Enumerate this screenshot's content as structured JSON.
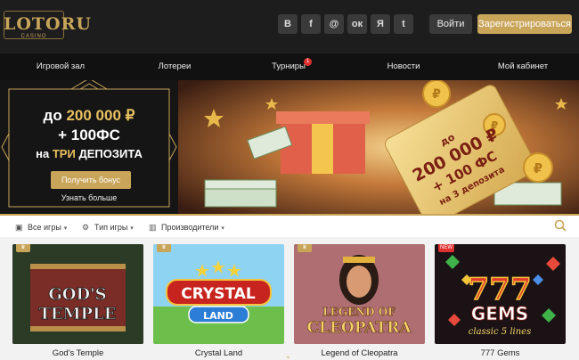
{
  "brand": {
    "logo_text": "LOTORU",
    "logo_sub": "CASINO"
  },
  "social": [
    "В",
    "f",
    "@",
    "ок",
    "Я",
    "t"
  ],
  "auth": {
    "login": "Войти",
    "register": "Зарегистрироваться"
  },
  "nav": {
    "items": [
      "Игровой зал",
      "Лотереи",
      "Турниры",
      "Новости",
      "Мой кабинет"
    ],
    "tournaments_badge": "1"
  },
  "promo": {
    "amount_prefix": "до",
    "amount": "200 000 ₽",
    "bonus": "+ 100ФС",
    "on_text": "на",
    "deposits_gold": "ТРИ",
    "deposits_text": "ДЕПОЗИТА",
    "button": "Получить бонус",
    "more": "Узнать больше"
  },
  "ticket": {
    "line1": "до",
    "line2": "200 000 ₽",
    "line3": "+ 100 ФС",
    "line4": "на 3 депозита"
  },
  "filters": {
    "all_games": "Все игры",
    "game_type": "Тип игры",
    "providers": "Производители"
  },
  "games": [
    {
      "name": "God's Temple",
      "art": "GOD'S TEMPLE",
      "tag": ""
    },
    {
      "name": "Crystal Land",
      "art": "CRYSTAL LAND",
      "tag": ""
    },
    {
      "name": "Legend of Cleopatra",
      "art": "LEGEND OF CLEOPATRA",
      "tag": ""
    },
    {
      "name": "777 Gems",
      "art": "777 GEMS",
      "tag": "NEW"
    }
  ],
  "colors": {
    "gold": "#c9a55a",
    "dark": "#1d1d1d",
    "accent_red": "#e03030"
  }
}
